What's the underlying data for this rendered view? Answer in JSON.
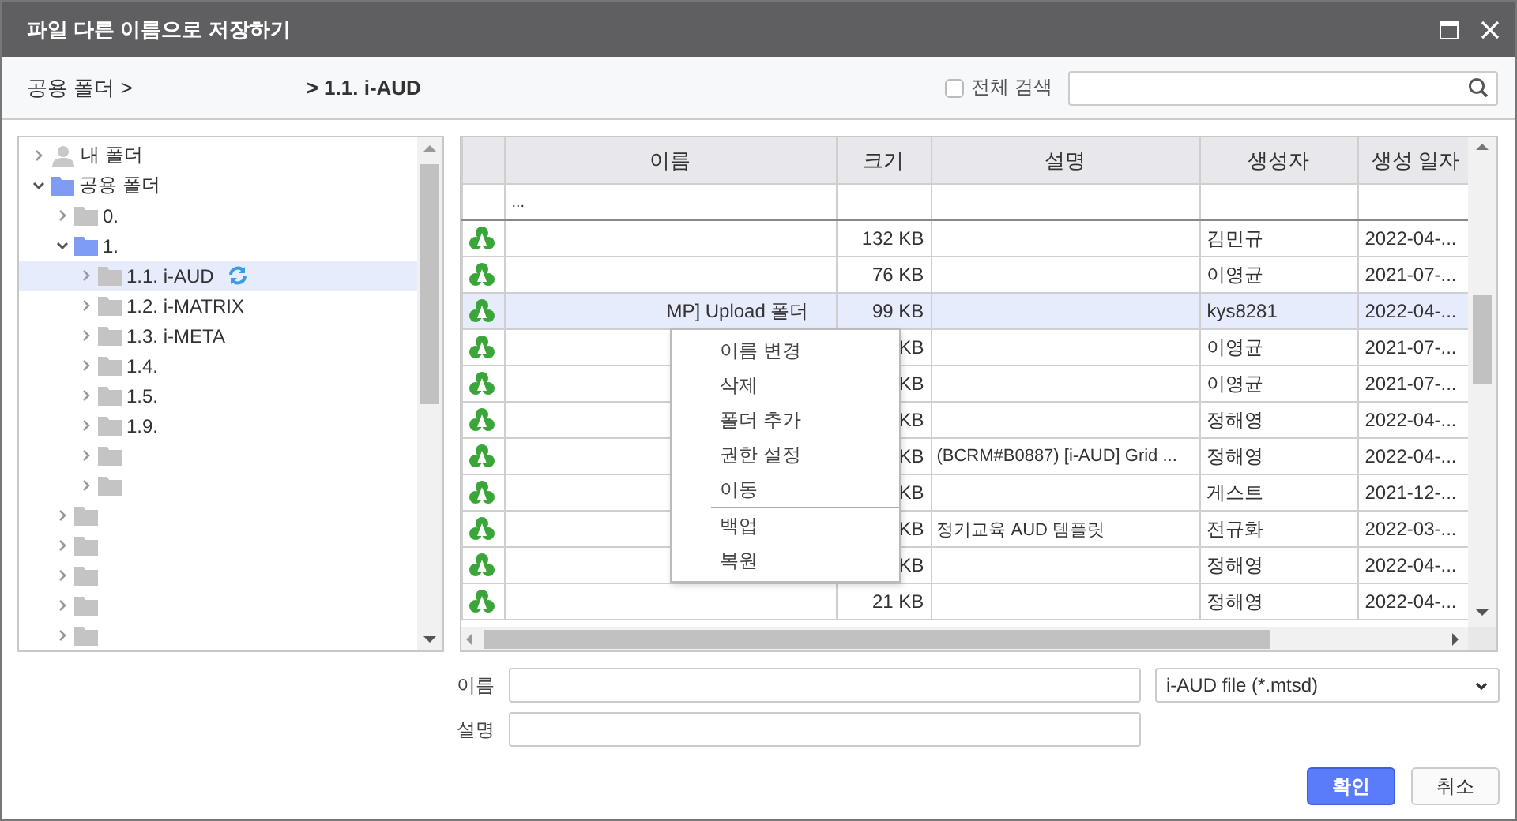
{
  "window": {
    "title": "파일 다른 이름으로 저장하기"
  },
  "breadcrumb": {
    "root": "공용 폴더 >",
    "current": "> 1.1. i-AUD"
  },
  "search": {
    "checkbox_label": "전체 검색",
    "checked": false
  },
  "tree": [
    {
      "label": "내 폴더",
      "kind": "user",
      "expanded": false,
      "selected": false
    },
    {
      "label": "공용 폴더",
      "kind": "folder",
      "expanded": true,
      "selected": false,
      "children": [
        {
          "label": "0.",
          "kind": "folder",
          "expanded": false,
          "selected": false
        },
        {
          "label": "1.",
          "kind": "folder",
          "expanded": true,
          "selected": false,
          "children": [
            {
              "label": "1.1. i-AUD",
              "kind": "folder",
              "expanded": false,
              "selected": true
            },
            {
              "label": "1.2. i-MATRIX",
              "kind": "folder",
              "expanded": false,
              "selected": false
            },
            {
              "label": "1.3. i-META",
              "kind": "folder",
              "expanded": false,
              "selected": false
            },
            {
              "label": "1.4.",
              "kind": "folder",
              "expanded": false,
              "selected": false
            },
            {
              "label": "1.5.",
              "kind": "folder",
              "expanded": false,
              "selected": false
            },
            {
              "label": "1.9.",
              "kind": "folder",
              "expanded": false,
              "selected": false
            },
            {
              "kind": "folder",
              "expanded": false,
              "selected": false
            },
            {
              "kind": "folder",
              "expanded": false,
              "selected": false
            }
          ]
        },
        {
          "kind": "folder",
          "expanded": false,
          "selected": false
        },
        {
          "kind": "folder",
          "expanded": false,
          "selected": false
        },
        {
          "kind": "folder",
          "expanded": false,
          "selected": false
        },
        {
          "kind": "folder",
          "expanded": false,
          "selected": false
        },
        {
          "kind": "folder",
          "expanded": false,
          "selected": false
        }
      ]
    }
  ],
  "table": {
    "columns": [
      "이름",
      "크기",
      "설명",
      "생성자",
      "생성 일자"
    ],
    "parent_row": "...",
    "rows": [
      {
        "size": "132 KB",
        "creator": "김민규",
        "date": "2022-04-...",
        "selected": false
      },
      {
        "size": "76 KB",
        "creator": "이영균",
        "date": "2021-07-...",
        "selected": false
      },
      {
        "name": "MP] Upload 폴더",
        "size": "99 KB",
        "creator": "kys8281",
        "date": "2022-04-...",
        "selected": true
      },
      {
        "size": "KB",
        "creator": "이영균",
        "date": "2021-07-...",
        "selected": false
      },
      {
        "size": "KB",
        "creator": "이영균",
        "date": "2021-07-...",
        "selected": false
      },
      {
        "size": "KB",
        "creator": "정해영",
        "date": "2022-04-...",
        "selected": false
      },
      {
        "size": "KB",
        "description": "(BCRM#B0887) [i-AUD] Grid ...",
        "creator": "정해영",
        "date": "2022-04-...",
        "selected": false
      },
      {
        "size": "KB",
        "creator": "게스트",
        "date": "2021-12-...",
        "selected": false
      },
      {
        "size": "KB",
        "description": "정기교육 AUD 템플릿",
        "creator": "전규화",
        "date": "2022-03-...",
        "selected": false
      },
      {
        "size": "KB",
        "creator": "정해영",
        "date": "2022-04-...",
        "selected": false
      },
      {
        "size": "21 KB",
        "creator": "정해영",
        "date": "2022-04-...",
        "selected": false
      }
    ]
  },
  "context_menu": [
    {
      "label": "이름 변경",
      "separator_before": false
    },
    {
      "label": "삭제",
      "separator_before": false
    },
    {
      "label": "폴더 추가",
      "separator_before": false
    },
    {
      "label": "권한 설정",
      "separator_before": false
    },
    {
      "label": "이동",
      "separator_before": false
    },
    {
      "label": "백업",
      "separator_before": true
    },
    {
      "label": "복원",
      "separator_before": false
    }
  ],
  "form": {
    "name_label": "이름",
    "description_label": "설명",
    "file_type": "i-AUD file (*.mtsd)"
  },
  "buttons": [
    {
      "label": "확인",
      "kind": "primary"
    },
    {
      "label": "취소",
      "kind": "secondary"
    }
  ]
}
